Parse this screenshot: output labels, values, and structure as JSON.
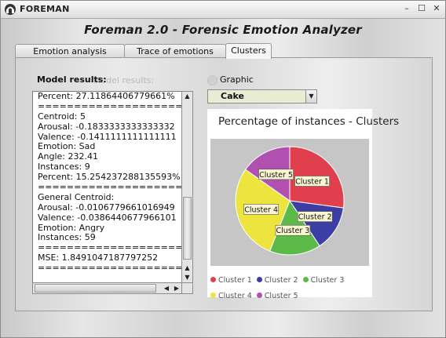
{
  "window": {
    "title": "FOREMAN",
    "minimize_icon": "minimize-icon",
    "maximize_icon": "maximize-icon",
    "close_icon": "close-icon",
    "minimize_glyph": "–",
    "maximize_glyph": "☐",
    "close_glyph": "✕"
  },
  "heading": "Foreman 2.0 - Forensic Emotion Analyzer",
  "tabs": [
    {
      "label": "Emotion analysis",
      "active": false
    },
    {
      "label": "Trace of emotions",
      "active": false
    },
    {
      "label": "Clusters",
      "active": true
    }
  ],
  "results": {
    "label": "Model results:",
    "ghost_label": "Model results:",
    "lines": [
      "Percent: 27.11864406779661%",
      "=================================",
      "Centroid: 5",
      "Arousal: -0.1833333333333332",
      "Valence: -0.1411111111111111",
      "Emotion: Sad",
      "Angle: 232.41",
      "Instances: 9",
      "Percent: 15.254237288135593%",
      "=================================",
      "General Centroid:",
      "Arousal: -0.0106779661016949",
      "Valence: -0.0386440677966101",
      "Emotion: Angry",
      "Instances: 59",
      "=================================",
      "MSE: 1.8491047187797252",
      "================================="
    ]
  },
  "graphic": {
    "label": "Graphic",
    "selected": "Cake",
    "dropdown_icon": "chevron-down-icon"
  },
  "colors": {
    "cluster1": "#e0404e",
    "cluster2": "#3c3ea6",
    "cluster3": "#5cba4a",
    "cluster4": "#eee43e",
    "cluster5": "#b050b0",
    "plot_bg": "#c6c6c6",
    "label_bg": "#fbf6d2"
  },
  "chart_data": {
    "type": "pie",
    "title": "Percentage of instances - Clusters",
    "slices": [
      {
        "label": "Cluster 1",
        "value": 27.1
      },
      {
        "label": "Cluster 2",
        "value": 13.6
      },
      {
        "label": "Cluster 3",
        "value": 15.3
      },
      {
        "label": "Cluster 4",
        "value": 28.8
      },
      {
        "label": "Cluster 5",
        "value": 15.2
      }
    ],
    "legend": [
      "Cluster 1",
      "Cluster 2",
      "Cluster 3",
      "Cluster 4",
      "Cluster 5"
    ],
    "legend_placement": "bottom"
  }
}
